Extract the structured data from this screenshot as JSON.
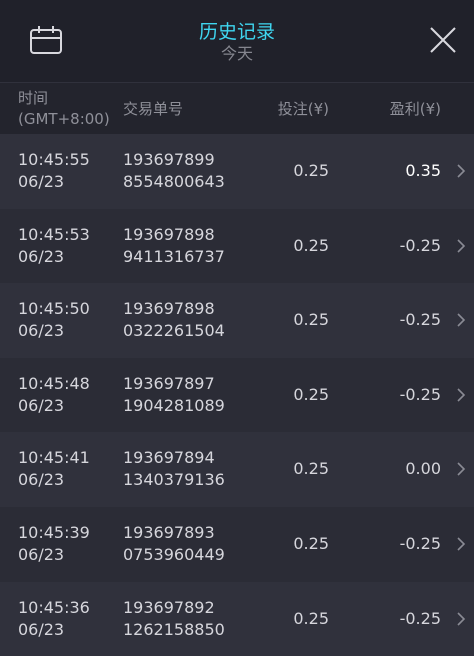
{
  "header": {
    "title": "历史记录",
    "subtitle": "今天",
    "calendar_icon": "calendar-icon",
    "close_icon": "close-icon"
  },
  "columns": {
    "time_line1": "时间",
    "time_line2": "(GMT+8:00)",
    "order": "交易单号",
    "bet": "投注(¥)",
    "profit": "盈利(¥)"
  },
  "rows": [
    {
      "time": "10:45:55",
      "date": "06/23",
      "order1": "193697899",
      "order2": "8554800643",
      "bet": "0.25",
      "profit": "0.35"
    },
    {
      "time": "10:45:53",
      "date": "06/23",
      "order1": "193697898",
      "order2": "9411316737",
      "bet": "0.25",
      "profit": "-0.25"
    },
    {
      "time": "10:45:50",
      "date": "06/23",
      "order1": "193697898",
      "order2": "0322261504",
      "bet": "0.25",
      "profit": "-0.25"
    },
    {
      "time": "10:45:48",
      "date": "06/23",
      "order1": "193697897",
      "order2": "1904281089",
      "bet": "0.25",
      "profit": "-0.25"
    },
    {
      "time": "10:45:41",
      "date": "06/23",
      "order1": "193697894",
      "order2": "1340379136",
      "bet": "0.25",
      "profit": "0.00"
    },
    {
      "time": "10:45:39",
      "date": "06/23",
      "order1": "193697893",
      "order2": "0753960449",
      "bet": "0.25",
      "profit": "-0.25"
    },
    {
      "time": "10:45:36",
      "date": "06/23",
      "order1": "193697892",
      "order2": "1262158850",
      "bet": "0.25",
      "profit": "-0.25"
    }
  ],
  "colors": {
    "accent": "#3fd6f0",
    "background": "#2b2c36",
    "header_bg": "#20212a"
  }
}
